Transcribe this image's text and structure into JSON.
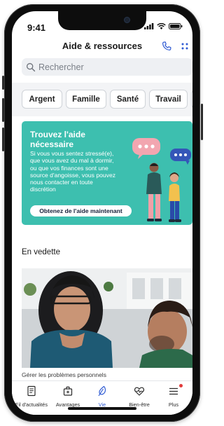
{
  "status_bar": {
    "time": "9:41"
  },
  "header": {
    "title": "Aide & ressources"
  },
  "search": {
    "placeholder": "Rechercher"
  },
  "categories": [
    "Argent",
    "Famille",
    "Santé",
    "Travail"
  ],
  "banner": {
    "title": "Trouvez l'aide nécessaire",
    "body": "Si vous vous sentez stressé(e), que vous avez du mal à dormir, ou que vos finances sont une source d'angoisse, vous pouvez nous contacter en toute discrétion",
    "button": "Obtenez de l'aide maintenant"
  },
  "featured": {
    "title": "En vedette",
    "caption": "Gérer les problèmes personnels"
  },
  "tabbar": {
    "tabs": [
      {
        "label": "Fil d'actualités",
        "icon": "news-feed-icon"
      },
      {
        "label": "Avantages",
        "icon": "briefcase-icon"
      },
      {
        "label": "Vie",
        "icon": "leaf-icon"
      },
      {
        "label": "Bien-être",
        "icon": "heart-pulse-icon"
      },
      {
        "label": "Plus",
        "icon": "menu-icon"
      }
    ],
    "active_index": 2
  },
  "colors": {
    "accent": "#2f5bd3",
    "banner_bg": "#3dbfaf",
    "notification_dot": "#e23b3b"
  }
}
